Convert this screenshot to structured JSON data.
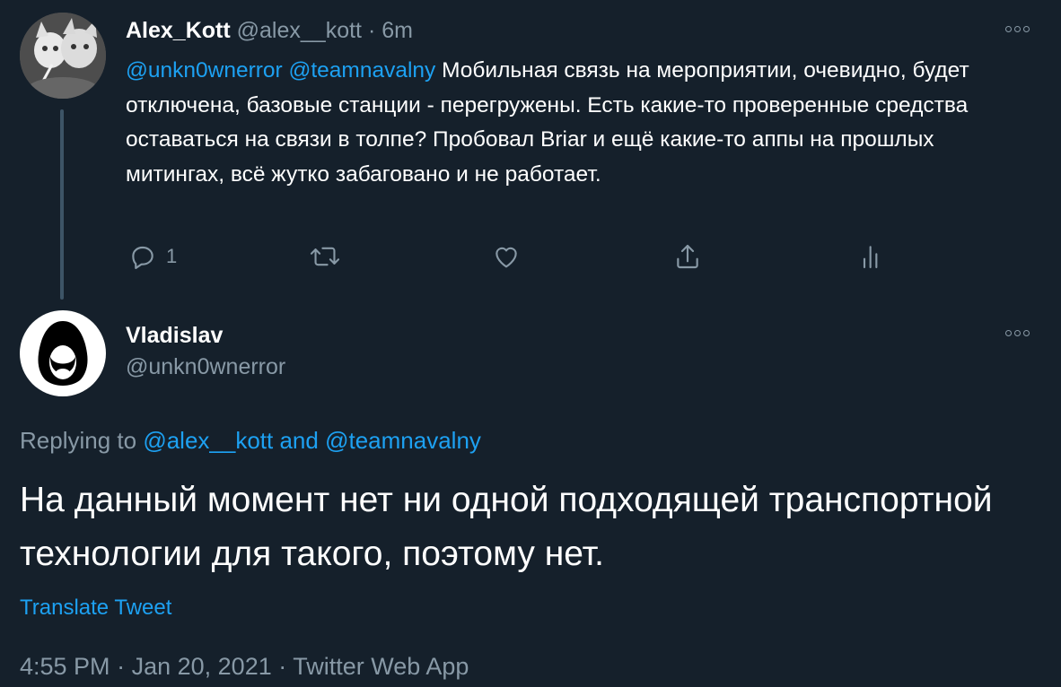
{
  "colors": {
    "background": "#15202b",
    "link": "#1da1f2",
    "muted": "#8899a6",
    "text": "#ffffff"
  },
  "tweet1": {
    "author_name": "Alex_Kott",
    "handle": "@alex__kott",
    "separator": "·",
    "time": "6m",
    "mention1": "@unkn0wnerror",
    "mention2": "@teamnavalny",
    "text": "Мобильная связь на мероприятии, очевидно, будет отключена, базовые станции - перегружены. Есть какие-то проверенные средства оставаться на связи в толпе? Пробовал Briar и ещё какие-то аппы на прошлых митингах, всё жутко забаговано и не работает.",
    "reply_count": "1",
    "actions": [
      "reply-icon",
      "retweet-icon",
      "like-icon",
      "share-icon",
      "analytics-icon"
    ]
  },
  "tweet2": {
    "author_name": "Vladislav",
    "handle": "@unkn0wnerror",
    "replying_prefix": "Replying to",
    "replying_to1": "@alex__kott",
    "replying_and": "and",
    "replying_to2": "@teamnavalny",
    "text": "На данный момент нет ни одной подходящей транспортной технологии для такого, поэтому нет.",
    "translate_label": "Translate Tweet",
    "timestamp": "4:55 PM",
    "date": "Jan 20, 2021",
    "sep": "·",
    "source": "Twitter Web App"
  }
}
